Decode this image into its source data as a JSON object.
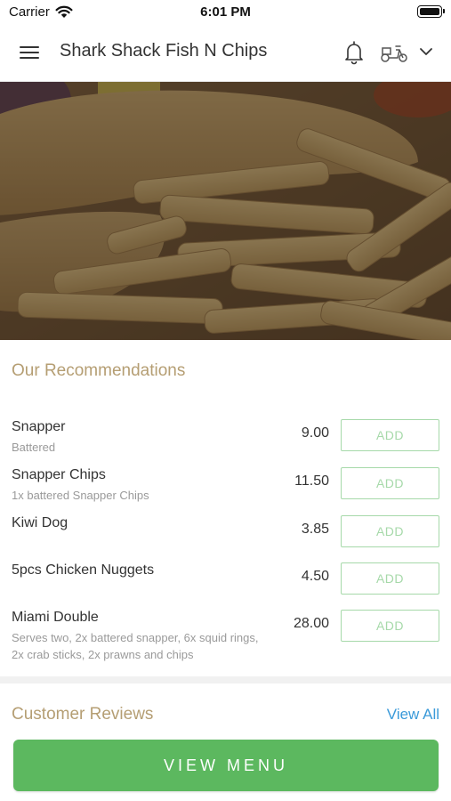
{
  "status_bar": {
    "carrier": "Carrier",
    "time": "6:01 PM"
  },
  "header": {
    "title": "Shark Shack Fish N Chips",
    "icons": [
      "menu-icon",
      "bell-icon",
      "scooter-icon",
      "chevron-down-icon"
    ]
  },
  "hero": {
    "image": "fish-and-chips-photo"
  },
  "recommendations": {
    "title": "Our Recommendations",
    "add_label": "ADD",
    "items": [
      {
        "name": "Snapper",
        "description": "Battered",
        "price": "9.00"
      },
      {
        "name": "Snapper Chips",
        "description": "1x battered Snapper Chips",
        "price": "11.50"
      },
      {
        "name": "Kiwi Dog",
        "description": "",
        "price": "3.85"
      },
      {
        "name": "5pcs Chicken Nuggets",
        "description": "",
        "price": "4.50"
      },
      {
        "name": "Miami Double",
        "description": "Serves two, 2x battered snapper, 6x squid rings, 2x crab sticks, 2x prawns and chips",
        "price": "28.00"
      }
    ]
  },
  "reviews": {
    "title": "Customer Reviews",
    "view_all_label": "View All"
  },
  "view_menu_label": "VIEW MENU",
  "colors": {
    "accent_gold": "#b59e73",
    "add_green": "#a6d9a9",
    "primary_green": "#5cb85f",
    "link_blue": "#3a9ad9"
  }
}
